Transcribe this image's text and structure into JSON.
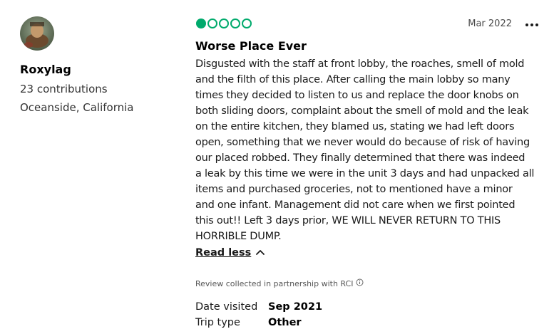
{
  "reviewer": {
    "name": "Roxylag",
    "contributions": "23 contributions",
    "location": "Oceanside, California"
  },
  "review": {
    "rating": 1,
    "rating_max": 5,
    "rating_color": "#00aa6c",
    "date": "Mar 2022",
    "title": "Worse Place Ever",
    "body_lines": [
      "Disgusted with the staff at front lobby, the roaches, smell of mold",
      "and the filth of this place. After calling the main lobby so many",
      "times they decided to listen to us and replace the door knobs on",
      "both sliding doors, complaint about the smell of mold and the leak",
      "on the entire kitchen, they blamed us, stating we had left doors",
      "open, something that we never would do because of risk of having",
      "our placed robbed. They finally determined that there was indeed",
      "a leak by this time we were in the unit 3 days and had unpacked all",
      "items and purchased groceries, not to mentioned have a minor",
      "and one infant. Management did not care when we first pointed",
      "this out!! Left 3 days prior, WE WILL NEVER RETURN TO THIS",
      "HORRIBLE DUMP."
    ],
    "read_less_label": "Read less",
    "collected_note": "Review collected in partnership with RCI",
    "details": [
      {
        "label": "Date visited",
        "value": "Sep 2021"
      },
      {
        "label": "Trip type",
        "value": "Other"
      }
    ]
  },
  "icons": {
    "more": "more-options-icon",
    "chevron": "chevron-up-icon",
    "info": "info-icon"
  }
}
